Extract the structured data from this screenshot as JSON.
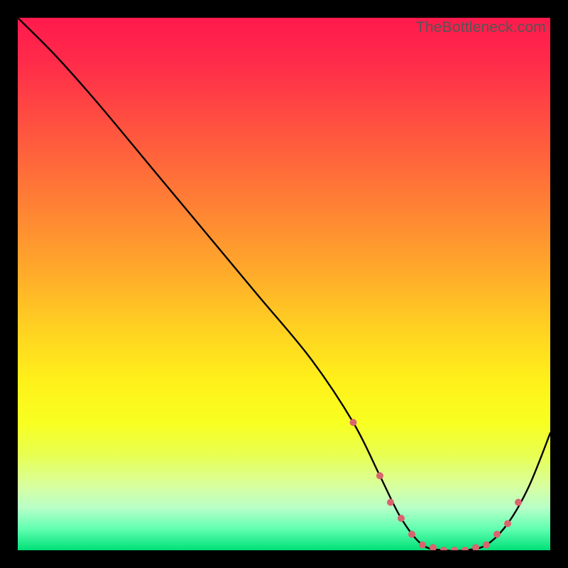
{
  "watermark": "TheBottleneck.com",
  "chart_data": {
    "type": "line",
    "title": "",
    "xlabel": "",
    "ylabel": "",
    "xlim": [
      0,
      100
    ],
    "ylim": [
      0,
      100
    ],
    "grid": false,
    "legend": false,
    "series": [
      {
        "name": "bottleneck-curve",
        "color": "#000000",
        "x": [
          0,
          7,
          15,
          25,
          35,
          45,
          55,
          63,
          68,
          72,
          76,
          80,
          84,
          88,
          92,
          96,
          100
        ],
        "y": [
          100,
          93,
          84,
          72,
          60,
          48,
          36,
          24,
          14,
          6,
          1,
          0,
          0,
          1,
          5,
          12,
          22
        ]
      }
    ],
    "markers": {
      "name": "highlight-points",
      "color": "#d9646e",
      "radius_px": 5,
      "x": [
        63,
        68,
        70,
        72,
        74,
        76,
        78,
        80,
        82,
        84,
        86,
        88,
        90,
        92,
        94
      ],
      "y": [
        24,
        14,
        9,
        6,
        3,
        1,
        0.5,
        0,
        0,
        0,
        0.5,
        1,
        3,
        5,
        9
      ]
    }
  }
}
